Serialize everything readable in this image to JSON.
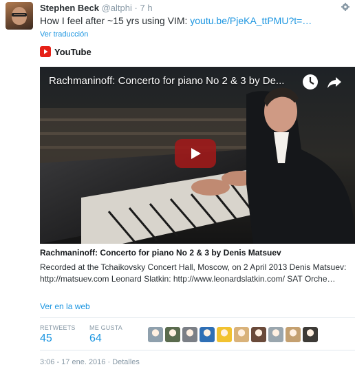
{
  "tweet": {
    "author_name": "Stephen Beck",
    "author_handle": "@altphi",
    "separator": "·",
    "time_ago": "7 h",
    "text_before": "How I feel after ~15 yrs using VIM: ",
    "link_text": "youtu.be/PjeKA_ttPMU?t=…",
    "translate_label": "Ver traducción"
  },
  "card": {
    "source_name": "YouTube",
    "video_title": "Rachmaninoff: Concerto for piano No 2 & 3 by De...",
    "title": "Rachmaninoff: Concerto for piano No 2 & 3 by Denis Matsuev",
    "description": "Recorded at the Tchaikovsky Concert Hall, Moscow, on 2 April 2013 Denis Matsuev: http://matsuev.com Leonard Slatkin: http://www.leonardslatkin.com/ SAT Orche…",
    "view_link": "Ver en la web"
  },
  "stats": {
    "retweets_label": "RETWEETS",
    "retweets_count": "45",
    "likes_label": "ME GUSTA",
    "likes_count": "64"
  },
  "likers": [
    {
      "icon": "user-avatar-icon",
      "color": "#8fa0ad"
    },
    {
      "icon": "user-avatar-icon",
      "color": "#5a6b4e"
    },
    {
      "icon": "user-avatar-icon",
      "color": "#7b7f86"
    },
    {
      "icon": "user-avatar-icon",
      "color": "#2f6fb5"
    },
    {
      "icon": "user-avatar-icon",
      "color": "#f2c230"
    },
    {
      "icon": "user-avatar-icon",
      "color": "#d9b27a"
    },
    {
      "icon": "user-avatar-icon",
      "color": "#6a4a3a"
    },
    {
      "icon": "user-avatar-icon",
      "color": "#9aa6ae"
    },
    {
      "icon": "user-avatar-icon",
      "color": "#c4a070"
    },
    {
      "icon": "user-avatar-icon",
      "color": "#3d3a36"
    }
  ],
  "footer": {
    "timestamp": "3:06 - 17 ene. 2016 · Detalles"
  },
  "colors": {
    "link": "#1b95e0",
    "youtube_red": "#e62117",
    "muted": "#8899a6"
  }
}
